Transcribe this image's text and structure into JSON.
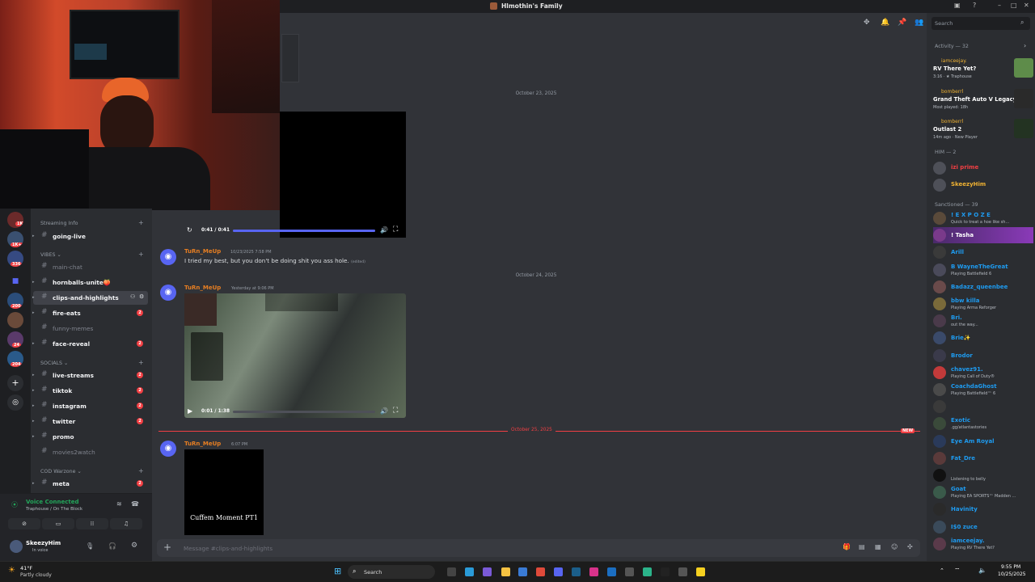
{
  "window": {
    "title": "Hlmothin's Family"
  },
  "header": {
    "search_placeholder": "Search"
  },
  "servers": [
    {
      "badge": "1K+"
    },
    {
      "badge": "336"
    },
    {
      "badge": ""
    },
    {
      "badge": "200"
    },
    {
      "badge": ""
    },
    {
      "badge": "24"
    },
    {
      "badge": "204"
    }
  ],
  "sidebar": {
    "categories": {
      "streaming": "Streaming Info",
      "vibes": "VIBES",
      "socials": "SOCIALS",
      "cod": "COD Warzone"
    },
    "channels": [
      {
        "name": "going-live",
        "count": ""
      },
      {
        "name": "main-chat",
        "count": ""
      },
      {
        "name": "hornballs-unite🍑",
        "count": ""
      },
      {
        "name": "clips-and-highlights",
        "count": ""
      },
      {
        "name": "fire-eats",
        "count": "2"
      },
      {
        "name": "funny-memes",
        "count": ""
      },
      {
        "name": "face-reveal",
        "count": "2"
      },
      {
        "name": "live-streams",
        "count": "2"
      },
      {
        "name": "tiktok",
        "count": "2"
      },
      {
        "name": "instagram",
        "count": "2"
      },
      {
        "name": "twitter",
        "count": "2"
      },
      {
        "name": "promo",
        "count": ""
      },
      {
        "name": "movies2watch",
        "count": ""
      },
      {
        "name": "meta",
        "count": "2"
      }
    ]
  },
  "voice": {
    "status": "Voice Connected",
    "location": "Traphouse / On The Block"
  },
  "user": {
    "name": "SkeezyHim",
    "status": "In voice"
  },
  "chat": {
    "dates": [
      "October 23, 2025",
      "October 24, 2025",
      "October 25, 2025"
    ],
    "new_label": "NEW",
    "messages": [
      {
        "author": "TuRn_MeUp",
        "time": "10/23/2025 7:58 PM",
        "text": "I tried my best, but you don't be doing shit you ass hole.",
        "edited": "(edited)"
      },
      {
        "author": "TuRn_MeUp",
        "time": "Yesterday at 9:06 PM",
        "text": ""
      },
      {
        "author": "TuRn_MeUp",
        "time": "6:07 PM",
        "text": ""
      }
    ],
    "video1": {
      "time": "0:41 / 0:41",
      "progress": 1.0
    },
    "video2": {
      "time": "0:01 / 1:38",
      "progress": 0.0
    },
    "video3_caption": "Cuffem Moment PT1",
    "composer_placeholder": "Message #clips-and-highlights"
  },
  "right": {
    "activity_title": "Activity — 32",
    "activities": [
      {
        "user": "iamceejay.",
        "title": "RV There Yet?",
        "sub": "3:16 · ★ Traphouse",
        "color": "#5e8c4a"
      },
      {
        "user": "bomberrl",
        "title": "Grand Theft Auto V Legacy",
        "sub": "Most played: 18h",
        "color": "#2a2a2a"
      },
      {
        "user": "bomberrl",
        "title": "Outlast 2",
        "sub": "14m ago · New Player",
        "color": "#233322"
      }
    ],
    "him_title": "HIM — 2",
    "him": [
      {
        "name": "izi prime",
        "sub": "",
        "color": "#f23f43"
      },
      {
        "name": "SkeezyHim",
        "sub": "",
        "color": "#f0b232"
      }
    ],
    "sanctioned_title": "Sanctioned — 39",
    "members": [
      {
        "name": "! E X P O Z E",
        "sub": "Quick to treat a hoe like sh...",
        "color": "#1e9bf0"
      },
      {
        "name": "! Tasha",
        "sub": "",
        "color": "#ffffff"
      },
      {
        "name": "Arill",
        "sub": "",
        "color": "#1e9bf0"
      },
      {
        "name": "B WayneTheGreat",
        "sub": "Playing Battlefield 6",
        "color": "#1e9bf0"
      },
      {
        "name": "Badazz_queenbee",
        "sub": "",
        "color": "#1e9bf0"
      },
      {
        "name": "bbw killa",
        "sub": "Playing Arma Reforger",
        "color": "#1e9bf0"
      },
      {
        "name": "Bri.",
        "sub": "out the way...",
        "color": "#1e9bf0"
      },
      {
        "name": "Brie✨",
        "sub": "",
        "color": "#1e9bf0"
      },
      {
        "name": "Brodor",
        "sub": "",
        "color": "#1e9bf0"
      },
      {
        "name": "chavez91.",
        "sub": "Playing Call of Duty®",
        "color": "#1e9bf0"
      },
      {
        "name": "CoachdaGhost",
        "sub": "Playing Battlefield™ 6",
        "color": "#1e9bf0"
      },
      {
        "name": "",
        "sub": "",
        "color": "#f23f43"
      },
      {
        "name": "Exotic",
        "sub": ".gg/atlantastories",
        "color": "#1e9bf0"
      },
      {
        "name": "Eye Am Royal",
        "sub": "",
        "color": "#1e9bf0"
      },
      {
        "name": "Fat_Dre",
        "sub": "",
        "color": "#1e9bf0"
      },
      {
        "name": "",
        "sub": "Listening to belly",
        "color": "#f23f43"
      },
      {
        "name": "Goat",
        "sub": "Playing EA SPORTS™ Madden ...",
        "color": "#1e9bf0"
      },
      {
        "name": "Havinity",
        "sub": "",
        "color": "#1e9bf0"
      },
      {
        "name": "I$0 zuce",
        "sub": "",
        "color": "#1e9bf0"
      },
      {
        "name": "iamceejay.",
        "sub": "Playing RV There Yet?",
        "color": "#1e9bf0"
      }
    ]
  },
  "taskbar": {
    "weather_temp": "41°F",
    "weather_desc": "Partly cloudy",
    "search": "Search",
    "time": "9:55 PM",
    "date": "10/25/2025"
  }
}
